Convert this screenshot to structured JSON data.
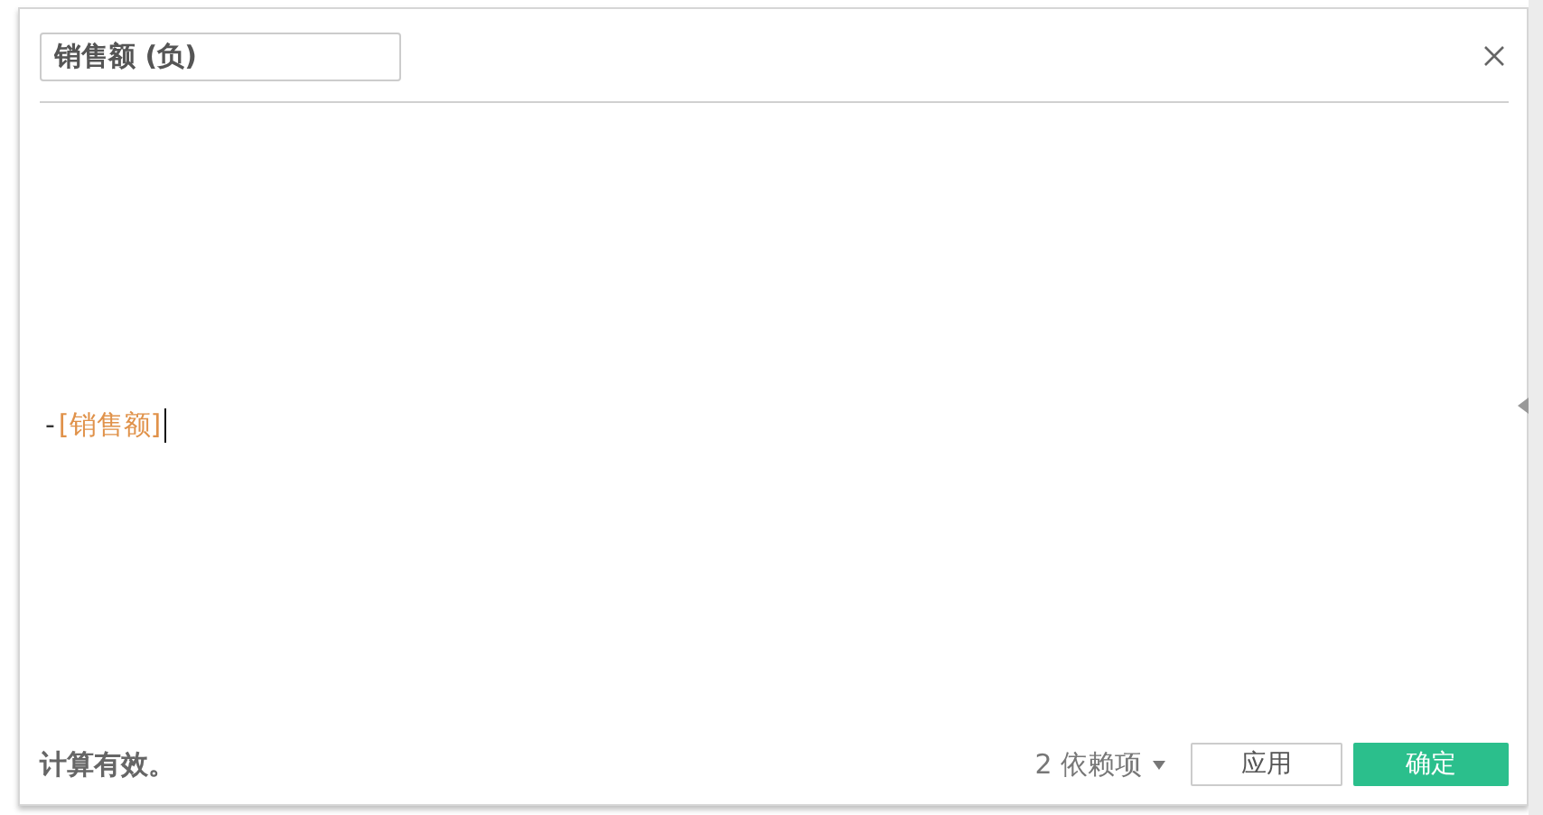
{
  "dialog": {
    "name_field": {
      "value": "销售额 (负)"
    },
    "formula": [
      {
        "kind": "operator",
        "text": "-"
      },
      {
        "kind": "field",
        "text": "[销售额]"
      }
    ],
    "status": "计算有效。",
    "dependencies": "2 依赖项",
    "buttons": [
      {
        "label": "应用",
        "kind": "secondary"
      },
      {
        "label": "确定",
        "kind": "primary"
      }
    ]
  }
}
